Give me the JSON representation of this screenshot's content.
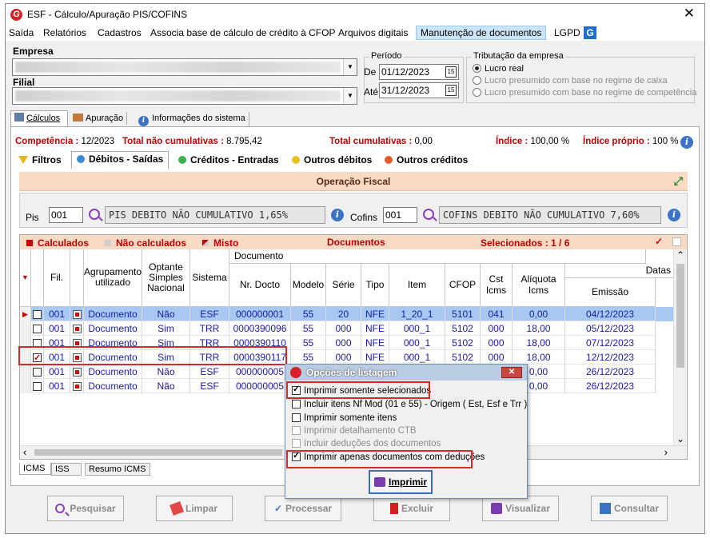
{
  "window": {
    "title": "ESF - Cálculo/Apuração PIS/COFINS",
    "close_glyph": "✕",
    "app_icon_letter": "G"
  },
  "menu": [
    "Saída",
    "Relatórios",
    "Cadastros",
    "Associa base de cálculo de crédito à CFOP",
    "Arquivos digitais",
    "Manutenção de documentos",
    "LGPD"
  ],
  "filters": {
    "empresa_label": "Empresa",
    "filial_label": "Filial",
    "periodo_title": "Período",
    "de_label": "De",
    "ate_label": "Até",
    "de_value": "01/12/2023",
    "ate_value": "31/12/2023",
    "calendar_glyph": "15",
    "tributacao_title": "Tributação da empresa",
    "tributacao_options": [
      "Lucro real",
      "Lucro presumido com base no regime de caixa",
      "Lucro presumido com base no regime de competência"
    ]
  },
  "main_tabs": [
    "Cálculos",
    "Apuração",
    "Informações do sistema"
  ],
  "summary": {
    "competencia_label": "Competência :",
    "competencia_value": "12/2023",
    "nao_cumulativas_label": "Total não cumulativas :",
    "nao_cumulativas_value": "8.795,42",
    "cumulativas_label": "Total cumulativas :",
    "cumulativas_value": "0,00",
    "indice_label": "Índice :",
    "indice_value": "100,00 %",
    "indice_proprio_label": "Índice próprio :",
    "indice_proprio_value": "100 %"
  },
  "sub_tabs": [
    "Filtros",
    "Débitos - Saídas",
    "Créditos - Entradas",
    "Outros débitos",
    "Outros créditos"
  ],
  "operacao": {
    "title": "Operação Fiscal",
    "pis_label": "Pis",
    "pis_code": "001",
    "pis_desc": "PIS DEBITO  NÃO CUMULATIVO 1,65%",
    "cofins_label": "Cofins",
    "cofins_code": "001",
    "cofins_desc": "COFINS DEBITO NÃO CUMULATIVO 7,60%"
  },
  "legend": {
    "calculados": "Calculados",
    "nao_calculados": "Não calculados",
    "misto": "Misto",
    "documentos": "Documentos",
    "selecionados": "Selecionados : 1 / 6",
    "colors": {
      "calculados": "#d00000",
      "nao_calculados": "#cfcfcf",
      "misto": "#d00000"
    }
  },
  "table": {
    "group_documento": "Documento",
    "group_datas": "Datas",
    "columns": [
      "Fil.",
      "Agrupamento utilizado",
      "Optante Simples Nacional",
      "Sistema",
      "Nr. Docto",
      "Modelo",
      "Série",
      "Tipo",
      "Item",
      "CFOP",
      "Cst Icms",
      "Alíquota Icms",
      "Emissão"
    ],
    "rows": [
      {
        "sel": false,
        "fil": "001",
        "agrup": "Documento",
        "optante": "Não",
        "sistema": "ESF",
        "nr": "000000001",
        "modelo": "55",
        "serie": "20",
        "tipo": "NFE",
        "item": "1_20_1",
        "cfop": "5101",
        "cst": "041",
        "aliq": "0,00",
        "emissao": "04/12/2023"
      },
      {
        "sel": false,
        "fil": "001",
        "agrup": "Documento",
        "optante": "Sim",
        "sistema": "TRR",
        "nr": "0000390096",
        "modelo": "55",
        "serie": "000",
        "tipo": "NFE",
        "item": "000_1",
        "cfop": "5102",
        "cst": "000",
        "aliq": "18,00",
        "emissao": "05/12/2023"
      },
      {
        "sel": false,
        "fil": "001",
        "agrup": "Documento",
        "optante": "Sim",
        "sistema": "TRR",
        "nr": "0000390110",
        "modelo": "55",
        "serie": "000",
        "tipo": "NFE",
        "item": "000_1",
        "cfop": "5102",
        "cst": "000",
        "aliq": "18,00",
        "emissao": "07/12/2023"
      },
      {
        "sel": true,
        "fil": "001",
        "agrup": "Documento",
        "optante": "Sim",
        "sistema": "TRR",
        "nr": "0000390117",
        "modelo": "55",
        "serie": "000",
        "tipo": "NFE",
        "item": "000_1",
        "cfop": "5102",
        "cst": "000",
        "aliq": "18,00",
        "emissao": "12/12/2023"
      },
      {
        "sel": false,
        "fil": "001",
        "agrup": "Documento",
        "optante": "Não",
        "sistema": "ESF",
        "nr": "000000005",
        "modelo": "",
        "serie": "",
        "tipo": "",
        "item": "",
        "cfop": "",
        "cst": "",
        "aliq": "0,00",
        "emissao": "26/12/2023"
      },
      {
        "sel": false,
        "fil": "001",
        "agrup": "Documento",
        "optante": "Não",
        "sistema": "ESF",
        "nr": "000000005",
        "modelo": "",
        "serie": "",
        "tipo": "",
        "item": "",
        "cfop": "",
        "cst": "",
        "aliq": "0,00",
        "emissao": "26/12/2023"
      }
    ]
  },
  "bottom_tabs": [
    "ICMS",
    "ISS",
    "Resumo ICMS"
  ],
  "popup": {
    "title": "Opções de listagem",
    "close_glyph": "✕",
    "options": [
      {
        "label": "Imprimir somente selecionados",
        "checked": true,
        "disabled": false
      },
      {
        "label": "Incluir itens Nf Mod (01 e 55) - Origem ( Est, Esf e Trr )",
        "checked": false,
        "disabled": false
      },
      {
        "label": "Imprimir somente itens",
        "checked": false,
        "disabled": false
      },
      {
        "label": "Imprimir detalhamento CTB",
        "checked": false,
        "disabled": true
      },
      {
        "label": "Incluir deduções dos documentos",
        "checked": false,
        "disabled": true
      },
      {
        "label": "Imprimir apenas documentos com deduções",
        "checked": true,
        "disabled": false
      }
    ],
    "print_button": "Imprimir"
  },
  "buttons": [
    "Pesquisar",
    "Limpar",
    "Processar",
    "Excluir",
    "Visualizar",
    "Consultar"
  ],
  "icons": {
    "help_glyph": "i",
    "expand_glyph": "⤢",
    "row_pointer": "▶",
    "sort_arrow": "▼",
    "check_glyph": "✓",
    "scroll_up": "⌃",
    "scroll_down": "⌄",
    "scroll_left": "‹",
    "scroll_right": "›"
  }
}
